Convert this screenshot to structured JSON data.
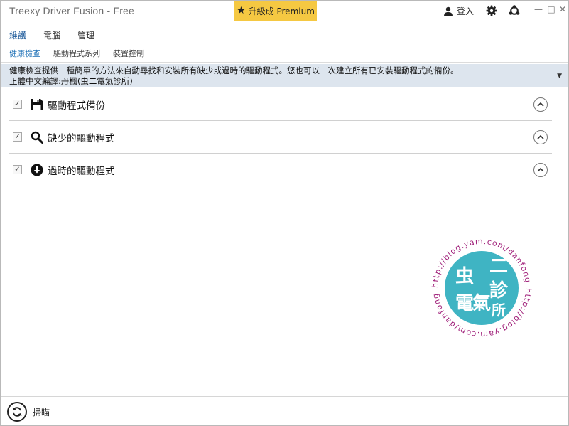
{
  "window": {
    "title": "Treexy Driver Fusion - Free",
    "controls": {
      "minimize": "—",
      "maximize": "□",
      "close": "✕"
    }
  },
  "header": {
    "premium_label": "升級成 Premium",
    "premium_icon": "star-icon",
    "login_label": "登入",
    "login_icon": "user-icon",
    "settings_icon": "gear-icon",
    "share_icon": "share-icon"
  },
  "menu": {
    "items": [
      {
        "label": "維護",
        "active": true
      },
      {
        "label": "電腦",
        "active": false
      },
      {
        "label": "管理",
        "active": false
      }
    ]
  },
  "tabs": {
    "items": [
      {
        "label": "健康檢查",
        "active": true
      },
      {
        "label": "驅動程式系列",
        "active": false
      },
      {
        "label": "裝置控制",
        "active": false
      }
    ]
  },
  "info": {
    "line1": "健康檢查提供一種簡單的方法來自動尋找和安裝所有缺少或過時的驅動程式。您也可以一次建立所有已安裝驅動程式的備份。",
    "line2": "正體中文編譯:丹楓(虫二電氣診所)"
  },
  "scan_items": [
    {
      "label": "驅動程式備份",
      "icon": "floppy-disk-icon",
      "checked": true
    },
    {
      "label": "缺少的驅動程式",
      "icon": "search-icon",
      "checked": true
    },
    {
      "label": "過時的驅動程式",
      "icon": "download-circle-icon",
      "checked": true
    }
  ],
  "watermark": {
    "url": "http://blog.yam.com/danfong",
    "seal_text": "虫二電氣診所"
  },
  "footer": {
    "scan_label": "掃瞄",
    "scan_icon": "refresh-icon"
  },
  "colors": {
    "premium_bg": "#f5c842",
    "accent": "#1a6eb5",
    "info_bg": "#dde5ee",
    "seal": "#3fb4c3",
    "seal_text": "#a0207a"
  }
}
